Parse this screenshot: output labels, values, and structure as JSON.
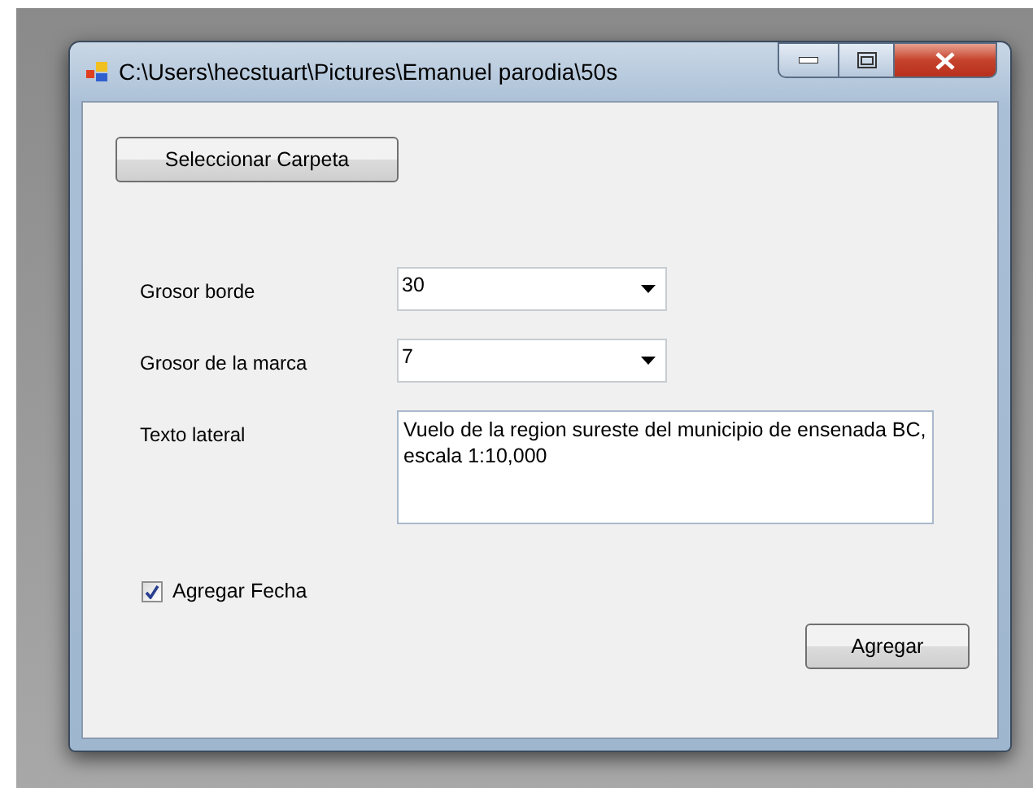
{
  "window": {
    "title": "C:\\Users\\hecstuart\\Pictures\\Emanuel parodia\\50s"
  },
  "select_folder_button": "Seleccionar Carpeta",
  "fields": [
    {
      "kind": "combo",
      "label": "Grosor borde",
      "value": "30"
    },
    {
      "kind": "combo",
      "label": "Grosor de la marca",
      "value": "7"
    },
    {
      "kind": "textarea",
      "label": "Texto lateral",
      "value": "Vuelo de la region sureste del municipio de ensenada BC, escala 1:10,000"
    }
  ],
  "add_date_checkbox": {
    "label": "Agregar Fecha",
    "checked": true
  },
  "add_button": "Agregar"
}
